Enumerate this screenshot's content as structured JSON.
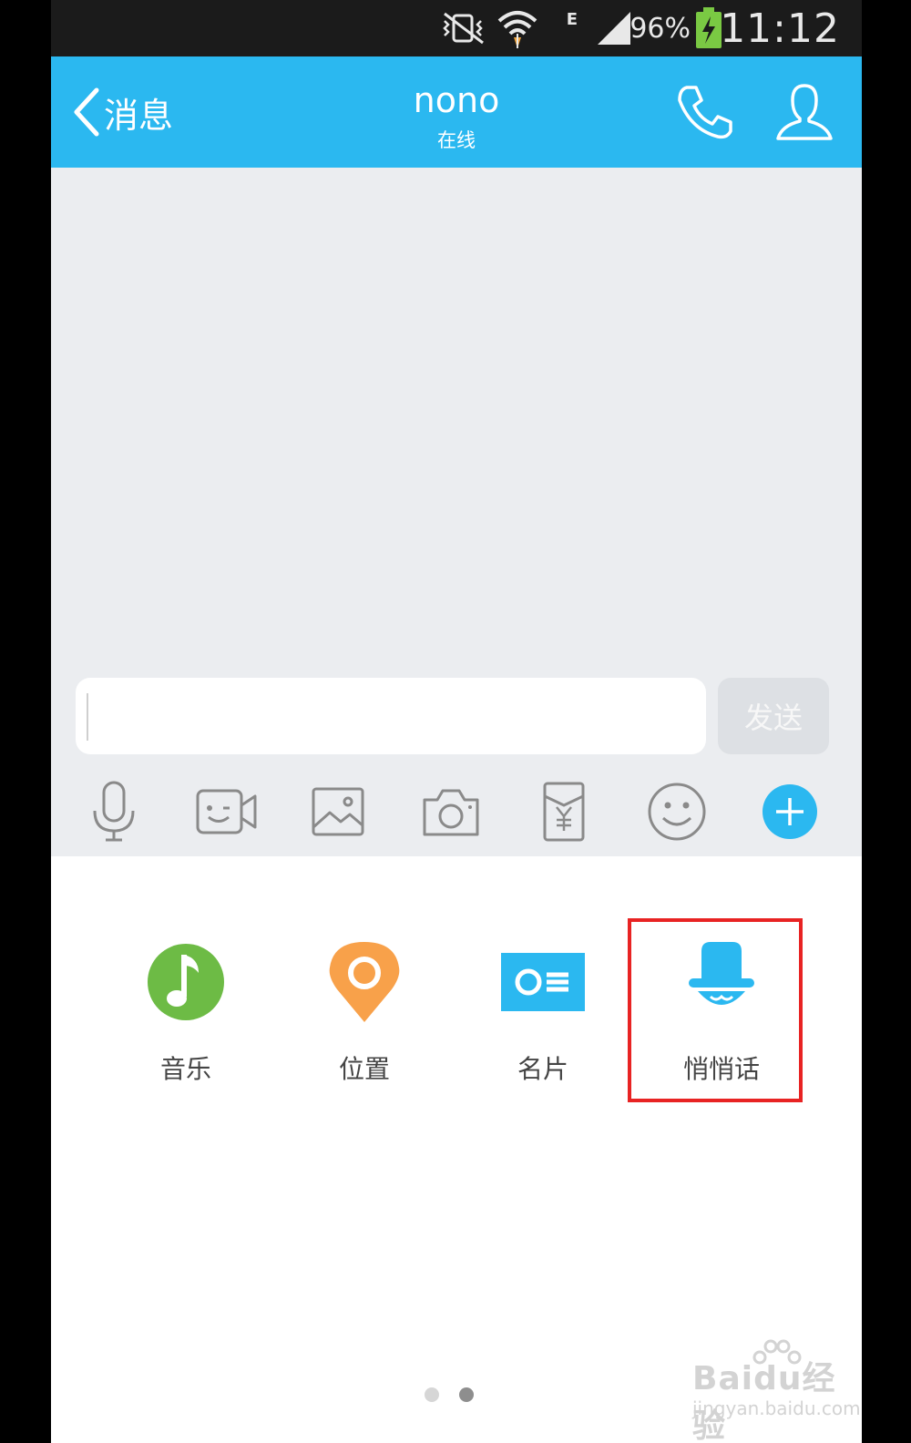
{
  "status_bar": {
    "network_type": "E",
    "battery_percent": "96%",
    "time": "11:12",
    "icons": [
      "mute-vibrate-icon",
      "wifi-icon",
      "signal-icon",
      "battery-charging-icon"
    ]
  },
  "header": {
    "back_label": "消息",
    "title": "nono",
    "subtitle": "在线",
    "icons": [
      "phone-icon",
      "profile-icon"
    ]
  },
  "chat": {
    "input_value": "",
    "send_label": "发送",
    "toolbar_icons": [
      "microphone-icon",
      "video-chat-icon",
      "image-icon",
      "camera-icon",
      "red-envelope-icon",
      "emoji-icon",
      "plus-icon"
    ]
  },
  "panel": {
    "items": [
      {
        "label": "音乐",
        "icon": "music-icon",
        "color": "#6dbb45"
      },
      {
        "label": "位置",
        "icon": "location-icon",
        "color": "#f8a14a"
      },
      {
        "label": "名片",
        "icon": "business-card-icon",
        "color": "#2bb8f0"
      },
      {
        "label": "悄悄话",
        "icon": "whisper-icon",
        "color": "#2bb8f0"
      }
    ],
    "highlighted_item": "悄悄话",
    "page_count": 2,
    "current_page": 2
  },
  "watermark": {
    "main": "Baidu经验",
    "sub": "jingyan.baidu.com"
  },
  "colors": {
    "accent": "#2bb8f0",
    "highlight": "#e82323"
  }
}
